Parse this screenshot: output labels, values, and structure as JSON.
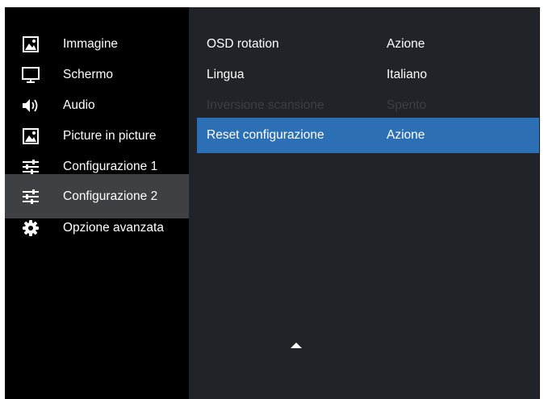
{
  "menu": {
    "items": [
      {
        "label": "Immagine",
        "icon": "image-icon"
      },
      {
        "label": "Schermo",
        "icon": "monitor-icon"
      },
      {
        "label": "Audio",
        "icon": "speaker-icon"
      },
      {
        "label": "Picture in picture",
        "icon": "image-icon"
      },
      {
        "label": "Configurazione 1",
        "icon": "sliders-icon"
      },
      {
        "label": "Configurazione 2",
        "icon": "sliders-icon",
        "selected": true
      },
      {
        "label": "Opzione avanzata",
        "icon": "gear-icon"
      }
    ]
  },
  "settings": {
    "rows": [
      {
        "name": "OSD rotation",
        "value": "Azione",
        "state": "enabled"
      },
      {
        "name": "Lingua",
        "value": "Italiano",
        "state": "enabled"
      },
      {
        "name": "Inversione scansione",
        "value": "Spento",
        "state": "disabled"
      },
      {
        "name": "Reset configurazione",
        "value": "Azione",
        "state": "highlighted"
      }
    ]
  },
  "colors": {
    "left_background": "#000000",
    "right_background": "#202429",
    "selected_menu": "#3f4044",
    "highlight": "#2c6fb5",
    "disabled_text": "#3a3f45",
    "text": "#ffffff"
  },
  "scroll": {
    "icon": "up-arrow-icon"
  }
}
